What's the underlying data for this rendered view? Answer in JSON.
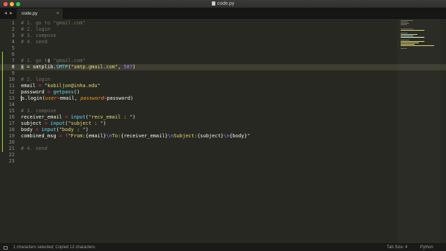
{
  "window": {
    "title": "code.py"
  },
  "tabs": [
    {
      "label": "code.py",
      "close": "×"
    }
  ],
  "nav": {
    "prev": "◂",
    "next": "▸"
  },
  "editor": {
    "line_numbers": [
      "1",
      "2",
      "3",
      "4",
      "5",
      "6",
      "7",
      "8",
      "9",
      "10",
      "11",
      "12",
      "13",
      "14",
      "15",
      "16",
      "17",
      "18",
      "19",
      "20",
      "21",
      "22",
      "23"
    ],
    "active_line": "8",
    "mouse_cursor": "I",
    "lines": {
      "l1": "# 1. go to \"gmail.com\"",
      "l2": "# 2. login",
      "l3": "# 3. compose",
      "l4": "# 4. send",
      "l7": "# 1. go to \"gmail.com\"",
      "l8": {
        "a": "s",
        "b": " = smtplib.",
        "c": "SMTP",
        "d": "(",
        "e": "\"smtp.gmail.com\"",
        "f": ", ",
        "g": "587",
        "h": ")"
      },
      "l10": "# 2. login",
      "l11": {
        "a": "email ",
        "b": "=",
        "c": " ",
        "d": "\"kobiljon@inha.edu\""
      },
      "l12": {
        "a": "password ",
        "b": "=",
        "c": " ",
        "d": "getpass",
        "e": "()"
      },
      "l13": {
        "a": "s",
        "b": ".login(",
        "c": "user",
        "d": "=",
        "e": "email, ",
        "f": "password",
        "g": "=",
        "h": "password)"
      },
      "l15": "# 3. compose",
      "l16": {
        "a": "receiver_email ",
        "b": "=",
        "c": " ",
        "d": "input",
        "e": "(",
        "f": "\"recv_email : \"",
        "g": ")"
      },
      "l17": {
        "a": "subject ",
        "b": "=",
        "c": " ",
        "d": "input",
        "e": "(",
        "f": "\"subject : \"",
        "g": ")"
      },
      "l18": {
        "a": "body ",
        "b": "=",
        "c": " ",
        "d": "input",
        "e": "(",
        "f": "\"body : \"",
        "g": ")"
      },
      "l19": {
        "a": "combined_msg ",
        "b": "=",
        "c": " ",
        "d": "f",
        "e": "\"From:",
        "f": "{email}",
        "g": "\\n",
        "h": "To:",
        "i": "{receiver_email}",
        "j": "\\n",
        "k": "Subject:",
        "l": "{subject}",
        "m": "\\n",
        "n": "{body}",
        "o": "\""
      },
      "l21": "# 4. send"
    }
  },
  "status": {
    "message": "1 characters selected; Copied 12 characters",
    "tab_size": "Tab Size: 4",
    "syntax": "Python"
  },
  "colors": {
    "background": "#272822",
    "comment": "#75715e",
    "keyword": "#f92672",
    "string": "#e6db74",
    "number": "#ae81ff",
    "function": "#66d9ef",
    "parameter": "#fd971f"
  }
}
